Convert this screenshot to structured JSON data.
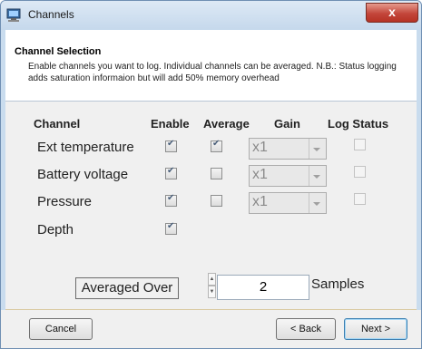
{
  "window": {
    "title": "Channels",
    "close_glyph": "x"
  },
  "header": {
    "title": "Channel Selection",
    "description": "Enable channels you want to log. Individual channels can be averaged. N.B.: Status logging adds saturation informaion but will add 50% memory overhead"
  },
  "columns": {
    "channel": "Channel",
    "enable": "Enable",
    "average": "Average",
    "gain": "Gain",
    "log_status": "Log Status"
  },
  "channels": [
    {
      "name": "Ext temperature",
      "enabled": true,
      "average": true,
      "gain": "x1",
      "log_status": false
    },
    {
      "name": "Battery voltage",
      "enabled": true,
      "average": false,
      "gain": "x1",
      "log_status": false
    },
    {
      "name": "Pressure",
      "enabled": true,
      "average": false,
      "gain": "x1",
      "log_status": false
    },
    {
      "name": "Depth",
      "enabled": true
    }
  ],
  "averaging": {
    "label": "Averaged Over",
    "value": "2",
    "unit": "Samples"
  },
  "buttons": {
    "cancel": "Cancel",
    "back": "< Back",
    "next": "Next >"
  },
  "icons": {
    "app": "channels-app-icon",
    "close": "close-icon",
    "spin_up": "spin-up-icon",
    "spin_down": "spin-down-icon",
    "dropdown": "chevron-down-icon"
  },
  "colors": {
    "titlebar": "#c5d8ec",
    "close_button": "#c3463a",
    "panel": "#f0f0f0",
    "default_button_border": "#3c7fb1"
  }
}
